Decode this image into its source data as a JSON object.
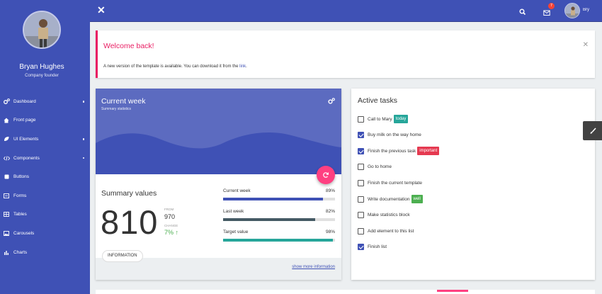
{
  "sidebar": {
    "user_name": "Bryan Hughes",
    "user_role": "Company founder",
    "items": [
      {
        "label": "Dashboard",
        "icon": "cogs-icon",
        "has_dot": true
      },
      {
        "label": "Front page",
        "icon": "home-icon",
        "has_dot": false
      },
      {
        "label": "UI Elements",
        "icon": "leaf-icon",
        "has_dot": true
      },
      {
        "label": "Components",
        "icon": "code-icon",
        "has_dot": true
      },
      {
        "label": "Buttons",
        "icon": "square-icon",
        "has_dot": false
      },
      {
        "label": "Forms",
        "icon": "form-icon",
        "has_dot": false
      },
      {
        "label": "Tables",
        "icon": "table-icon",
        "has_dot": false
      },
      {
        "label": "Carousels",
        "icon": "image-icon",
        "has_dot": false
      },
      {
        "label": "Charts",
        "icon": "bar-chart-icon",
        "has_dot": false
      }
    ]
  },
  "topbar": {
    "mail_count": "7",
    "user_short": "Bry"
  },
  "welcome": {
    "title": "Welcome back!",
    "message_prefix": "A new version of the template is available. You can download it from the ",
    "link_text": "link",
    "message_suffix": "."
  },
  "week_card": {
    "title": "Current week",
    "subtitle": "Summary statistics",
    "summary_title": "Summary values",
    "big_value": "810",
    "from_label": "FROM",
    "from_value": "970",
    "change_label": "CHANGE",
    "change_value": "7% ↑",
    "progress": [
      {
        "label": "Current week",
        "value_text": "89%",
        "value": 89,
        "color": "#3f51b5"
      },
      {
        "label": "Last week",
        "value_text": "82%",
        "value": 82,
        "color": "#455a64"
      },
      {
        "label": "Target value",
        "value_text": "98%",
        "value": 98,
        "color": "#26a69a"
      }
    ],
    "info_button": "INFORMATION",
    "show_more": "show more information"
  },
  "tasks": {
    "title": "Active tasks",
    "items": [
      {
        "text": "Call to Mary",
        "checked": false,
        "tag": "today",
        "tag_color": "#26a69a"
      },
      {
        "text": "Buy milk on the way home",
        "checked": true,
        "tag": "",
        "tag_color": ""
      },
      {
        "text": "Finish the previous task",
        "checked": true,
        "tag": "important",
        "tag_color": "#e53950"
      },
      {
        "text": "Go to home",
        "checked": false,
        "tag": "",
        "tag_color": ""
      },
      {
        "text": "Finish the current template",
        "checked": false,
        "tag": "",
        "tag_color": ""
      },
      {
        "text": "Write documentation",
        "checked": false,
        "tag": "well",
        "tag_color": "#4caf50"
      },
      {
        "text": "Make statistics block",
        "checked": false,
        "tag": "",
        "tag_color": ""
      },
      {
        "text": "Add element to this list",
        "checked": false,
        "tag": "",
        "tag_color": ""
      },
      {
        "text": "Finish list",
        "checked": true,
        "tag": "",
        "tag_color": ""
      }
    ]
  },
  "colors": {
    "primary": "#3f51b5",
    "accent": "#ff4081",
    "welcome_title": "#e91e63"
  }
}
